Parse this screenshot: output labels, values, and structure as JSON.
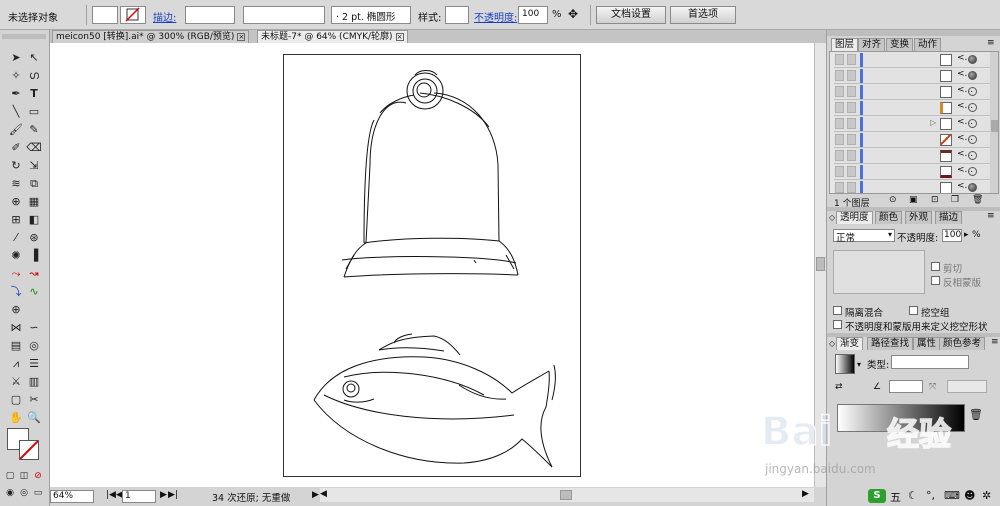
{
  "control_bar": {
    "selection": "未选择对象",
    "stroke_label": "描边:",
    "brush_label": "· 2 pt. 椭圆形",
    "style_label": "样式:",
    "opacity_label": "不透明度:",
    "opacity_value": "100",
    "percent": "%",
    "doc_setup": "文档设置",
    "preferences": "首选项"
  },
  "tabs": [
    {
      "label": "meicon50 [转换].ai* @ 300% (RGB/预览)"
    },
    {
      "label": "未标题-7* @ 64% (CMYK/轮廓)"
    }
  ],
  "status": {
    "zoom": "64%",
    "page": "1",
    "history": "34 次还原; 无重做"
  },
  "layers_panel": {
    "tabs": [
      "图层",
      "对齐",
      "变换",
      "动作"
    ],
    "rows_count_label": "1 个图层",
    "row_name": "<..."
  },
  "transparency_panel": {
    "tabs": [
      "透明度",
      "颜色",
      "外观",
      "描边"
    ],
    "blend_mode": "正常",
    "opacity_label": "不透明度:",
    "opacity_value": "100",
    "percent": "%",
    "clip": "剪切",
    "invert_mask": "反相蒙版",
    "isolate_blending": "隔离混合",
    "knockout_group": "挖空组",
    "opacity_mask_knockout": "不透明度和蒙版用来定义挖空形状"
  },
  "gradient_panel": {
    "tabs": [
      "渐变",
      "路径查找",
      "属性",
      "颜色参考"
    ],
    "type_label": "类型:"
  },
  "colors": {
    "accent_blue": "#4a6fe0",
    "link_blue": "#1a3fc4"
  }
}
